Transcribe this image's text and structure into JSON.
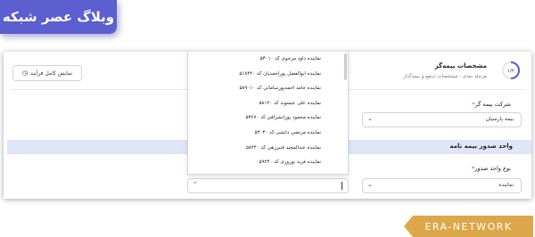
{
  "watermark_top": "وبلاگ عصر شبکه",
  "watermark_bottom": "ERA-NETWORK",
  "toolbar": {
    "full_process_label": "نمایش کامل فرآیند"
  },
  "step": {
    "progress": "۱/۲",
    "title": "مشخصات بیمه‌گر",
    "subtitle": "مرحله بعدی : مشخصات ذینفع و بیمه‌گذار"
  },
  "insurer": {
    "label": "شرکت بیمه گر",
    "required_mark": "*",
    "value": "بیمه پارسیان"
  },
  "section": {
    "title": "واحد صدور بیمه نامه"
  },
  "issuing_unit_type": {
    "label": "نوع واحد صدور",
    "required_mark": "*",
    "value": "نماینده"
  },
  "agent_dropdown": {
    "options": [
      "نماینده داود مرجوی کد ۵۳۰۱۰",
      "نماینده ابوالفضل پوراحمدیان کد ۵۱۸۴۴۰",
      "نماینده حامد احمدپورساماني کد ۵۸۹۰۱۰",
      "نماینده علی عبسوند کد ۵۸۱۲۰",
      "نماینده محمود پورانشرافي کد ۵۳۶۷۰",
      "نماینده مرتضي داتشی کد ۵۳۰۳۰",
      "نماینده عبدالمجید قنبرزهي کد ۵۸۴۴۰",
      "نماینده فرید نوروزی کد ۵۹۲۴۰"
    ]
  },
  "colors": {
    "accent": "#5b5fcf",
    "band": "#dfe6f7",
    "required": "#e53935",
    "era_bg": "#dca74a"
  },
  "icons": {
    "full_process": "clock-icon",
    "select_arrow": "chevron-down-icon"
  }
}
